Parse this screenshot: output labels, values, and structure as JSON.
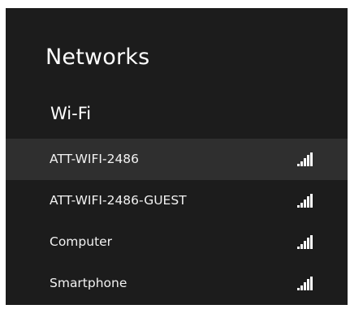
{
  "header": {
    "title": "Networks"
  },
  "wifi_section": {
    "label": "Wi-Fi",
    "networks": [
      {
        "name": "ATT-WIFI-2486",
        "signal_icon": "wifi-signal-icon",
        "signal_bars": 5,
        "selected": true
      },
      {
        "name": "ATT-WIFI-2486-GUEST",
        "signal_icon": "wifi-signal-icon",
        "signal_bars": 5,
        "selected": false
      },
      {
        "name": "Computer",
        "signal_icon": "wifi-signal-icon",
        "signal_bars": 5,
        "selected": false
      },
      {
        "name": "Smartphone",
        "signal_icon": "wifi-signal-icon",
        "signal_bars": 5,
        "selected": false
      }
    ]
  },
  "colors": {
    "panel_background": "#1c1c1c",
    "selected_row": "#2f2f2f",
    "text": "#ffffff",
    "page_background": "#ffffff"
  }
}
